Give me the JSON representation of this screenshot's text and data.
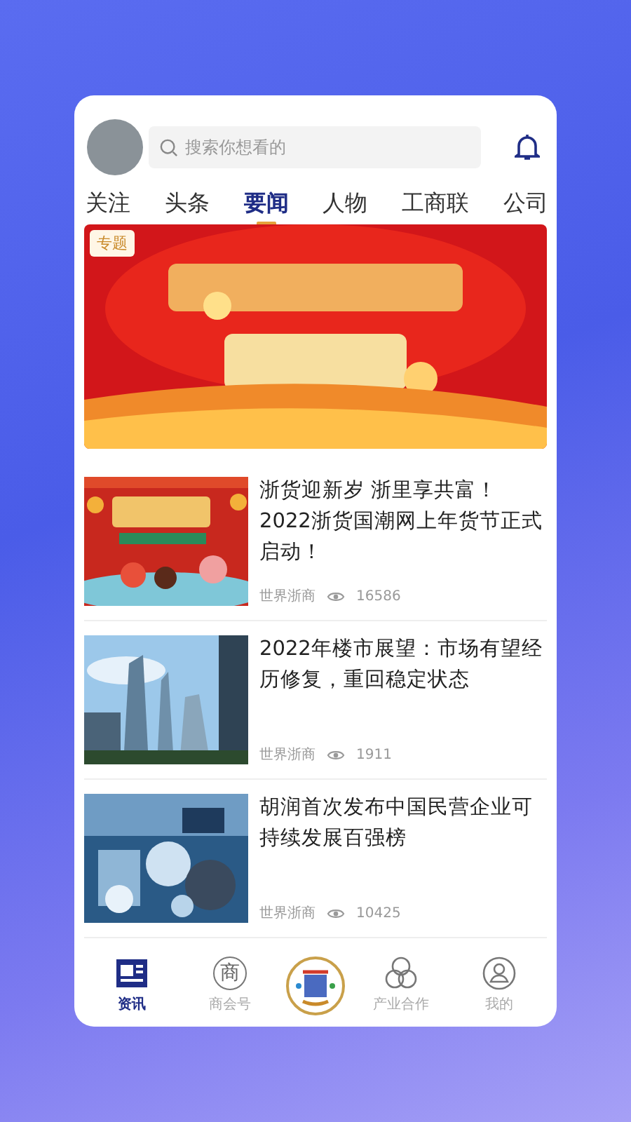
{
  "header": {
    "search": {
      "placeholder": "搜索你想看的"
    }
  },
  "tabs": [
    {
      "label": "关注",
      "selected": false
    },
    {
      "label": "头条",
      "selected": false
    },
    {
      "label": "要闻",
      "selected": true
    },
    {
      "label": "人物",
      "selected": false
    },
    {
      "label": "工商联",
      "selected": false
    },
    {
      "label": "公司",
      "selected": false
    }
  ],
  "banner": {
    "kind": "picture",
    "badge": "专题"
  },
  "articles": [
    {
      "title": "浙货迎新岁 浙里享共富！2022浙货国潮网上年货节正式启动！",
      "source": "世界浙商",
      "views": "16586"
    },
    {
      "title": "2022年楼市展望：市场有望经历修复，重回稳定状态",
      "source": "世界浙商",
      "views": "1911"
    },
    {
      "title": "胡润首次发布中国民营企业可持续发展百强榜",
      "source": "世界浙商",
      "views": "10425"
    }
  ],
  "bottom_nav": [
    {
      "kind": "news",
      "label": "资讯",
      "selected": true
    },
    {
      "kind": "char",
      "glyph": "商",
      "label": "商会号",
      "selected": false
    },
    {
      "kind": "emblem"
    },
    {
      "kind": "circles",
      "label": "产业合作",
      "selected": false
    },
    {
      "kind": "person",
      "label": "我的",
      "selected": false
    }
  ]
}
